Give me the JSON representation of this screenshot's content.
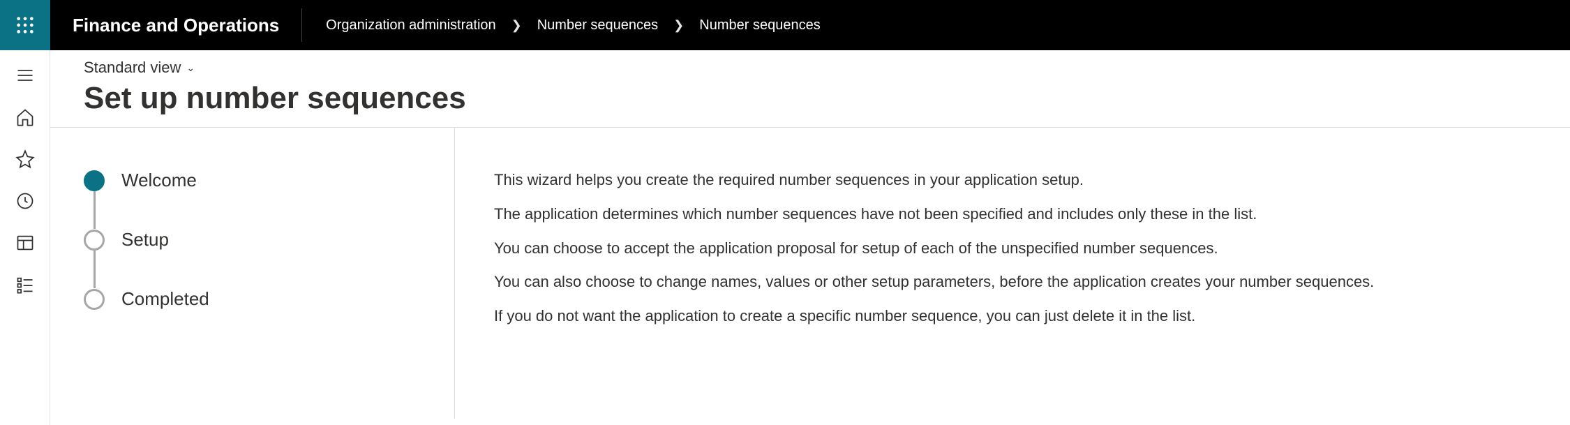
{
  "header": {
    "title": "Finance and Operations",
    "breadcrumb": [
      "Organization administration",
      "Number sequences",
      "Number sequences"
    ]
  },
  "view": {
    "label": "Standard view"
  },
  "page": {
    "title": "Set up number sequences"
  },
  "wizard": {
    "steps": [
      {
        "label": "Welcome",
        "active": true
      },
      {
        "label": "Setup",
        "active": false
      },
      {
        "label": "Completed",
        "active": false
      }
    ]
  },
  "body": {
    "paragraphs": [
      "This wizard helps you create the required number sequences in your application setup.",
      "The application determines which number sequences have not been specified and includes only these in the list.",
      "You can choose to accept the application proposal for setup of each of the unspecified number sequences.",
      "You can also choose to change names, values or other setup parameters, before the application creates your number sequences.",
      "If you do not want the application to create a specific number sequence, you can just delete it in the list."
    ]
  }
}
